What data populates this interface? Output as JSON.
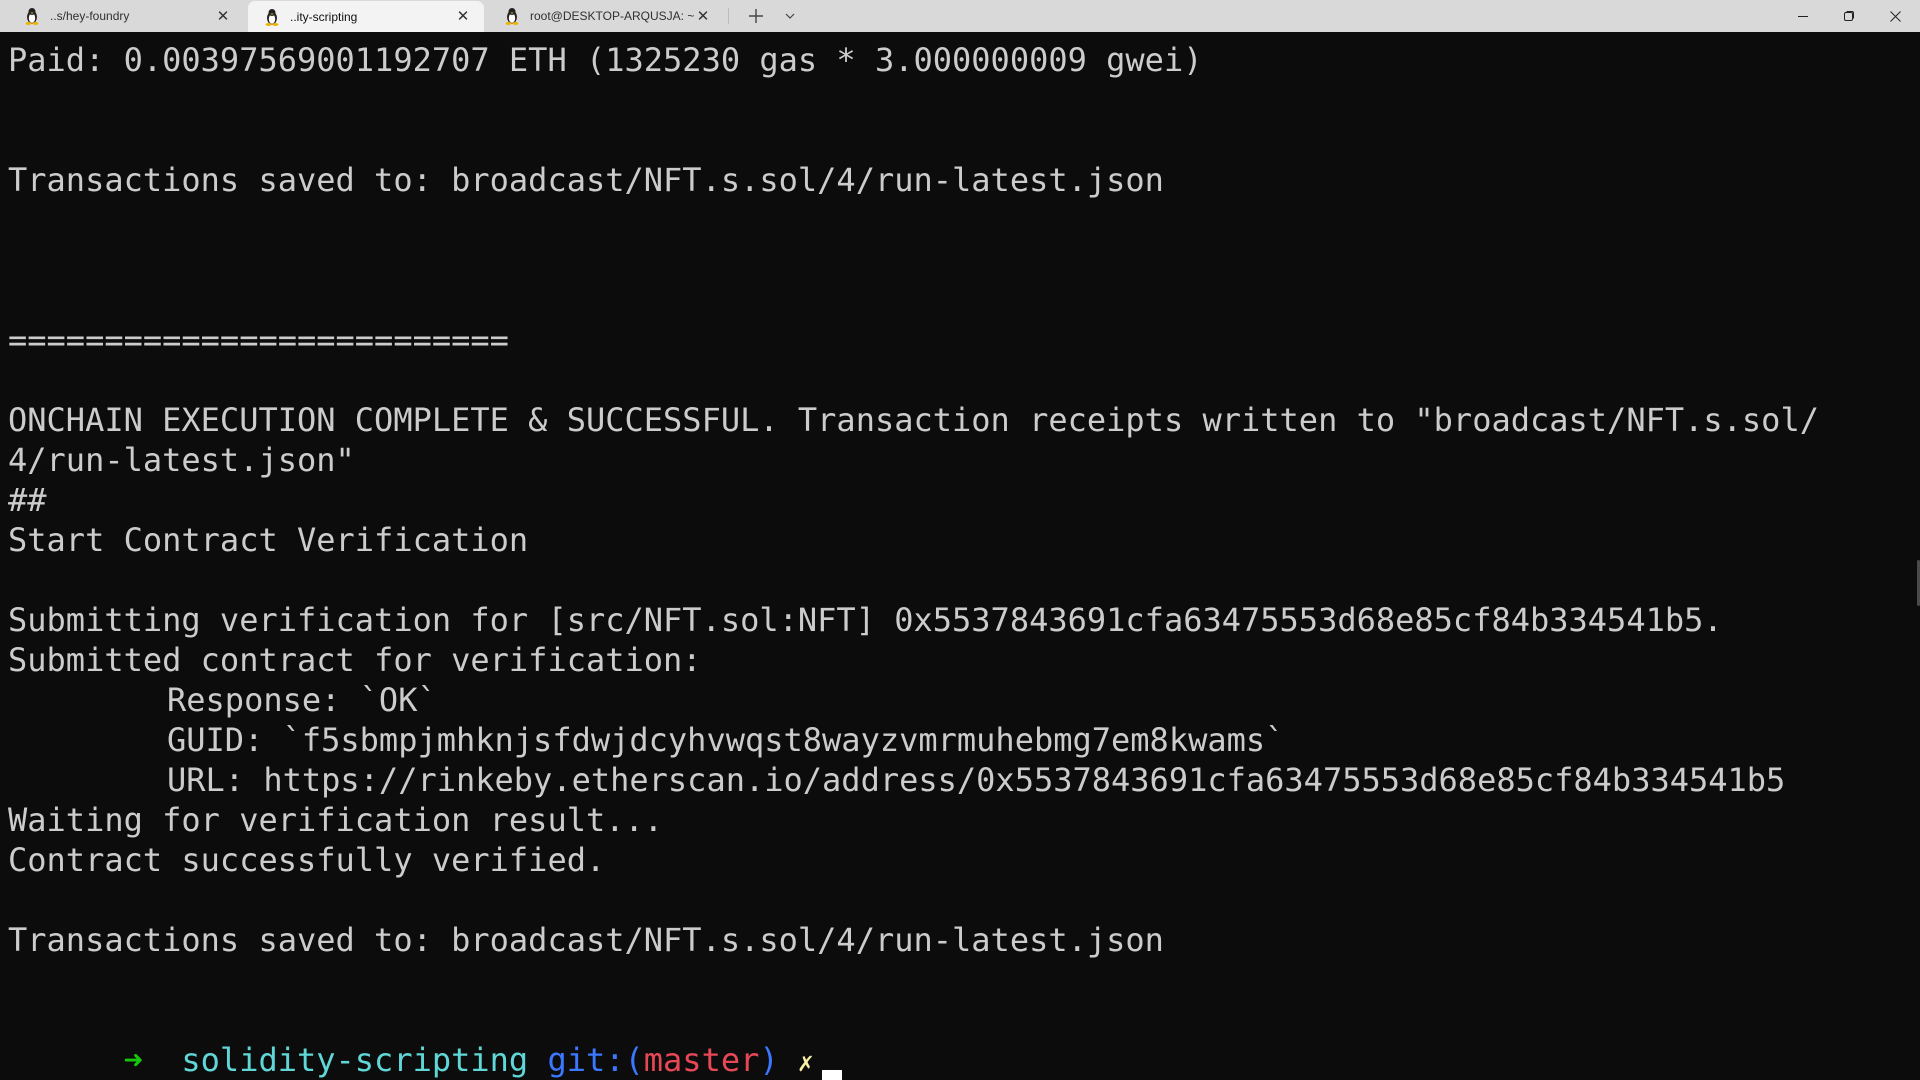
{
  "window": {
    "tabs": [
      {
        "label": "..s/hey-foundry",
        "icon": "linux-penguin-icon",
        "active": false
      },
      {
        "label": "..ity-scripting",
        "icon": "linux-penguin-icon",
        "active": true
      },
      {
        "label": "root@DESKTOP-ARQUSJA: ~",
        "icon": "linux-penguin-icon",
        "active": false
      }
    ],
    "close_glyph": "✕",
    "new_tab_glyph": "+",
    "dropdown_glyph": "⌄"
  },
  "terminal": {
    "lines": [
      "Paid: 0.00397569001192707 ETH (1325230 gas * 3.000000009 gwei)",
      "Transactions saved to: broadcast/NFT.s.sol/4/run-latest.json",
      "==========================",
      "ONCHAIN EXECUTION COMPLETE & SUCCESSFUL. Transaction receipts written to \"broadcast/NFT.s.sol/",
      "4/run-latest.json\"",
      "##",
      "Start Contract Verification",
      "Submitting verification for [src/NFT.sol:NFT] 0x5537843691cfa63475553d68e85cf84b334541b5.",
      "Submitted contract for verification:",
      "Response: `OK`",
      "GUID: `f5sbmpjmhknjsfdwjdcyhvwqst8wayzvmrmuhebmg7em8kwams`",
      "URL: https://rinkeby.etherscan.io/address/0x5537843691cfa63475553d68e85cf84b334541b5",
      "Waiting for verification result...",
      "Contract successfully verified.",
      "Transactions saved to: broadcast/NFT.s.sol/4/run-latest.json"
    ],
    "prompt": {
      "arrow": "➜",
      "directory": "solidity-scripting",
      "git_label": "git:(",
      "branch": "master",
      "git_close": ")",
      "dirty_marker": "✗"
    },
    "colors": {
      "background": "#0c0c0c",
      "foreground": "#cccccc",
      "prompt_arrow": "#16c60c",
      "prompt_dir": "#61d6d6",
      "prompt_git": "#3b78ff",
      "prompt_branch": "#e74856",
      "prompt_dirty": "#f9f1a5"
    }
  }
}
